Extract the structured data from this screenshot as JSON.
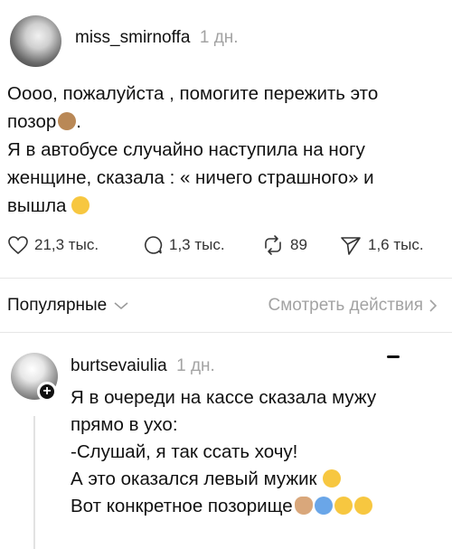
{
  "post": {
    "username": "miss_smirnoffa",
    "time": "1 дн.",
    "lines": [
      "Оооо, пожалуйста , помогите пережить это",
      "позор",
      "Я в автобусе случайно наступила на ногу",
      "женщине, сказала : « ничего страшного» и",
      "вышла"
    ],
    "punct_after_emoji": ".",
    "emojis": {
      "line2": "see-no-evil-monkey-icon",
      "line5": "melting-face-icon"
    },
    "actions": {
      "likes": "21,3 тыс.",
      "comments": "1,3 тыс.",
      "reposts": "89",
      "shares": "1,6 тыс."
    }
  },
  "filter": {
    "label": "Популярные",
    "see_actions": "Смотреть действия"
  },
  "reply": {
    "username": "burtsevaiulia",
    "time": "1 дн.",
    "lines": [
      "Я в очереди на кассе сказала мужу",
      "прямо в ухо:",
      "-Слушай, я так ссать хочу!",
      "А это оказался левый мужик",
      "Вот конкретное позорище"
    ]
  },
  "colors": {
    "text": "#111111",
    "muted": "#a3a3a3",
    "divider": "#e6e6e6"
  }
}
